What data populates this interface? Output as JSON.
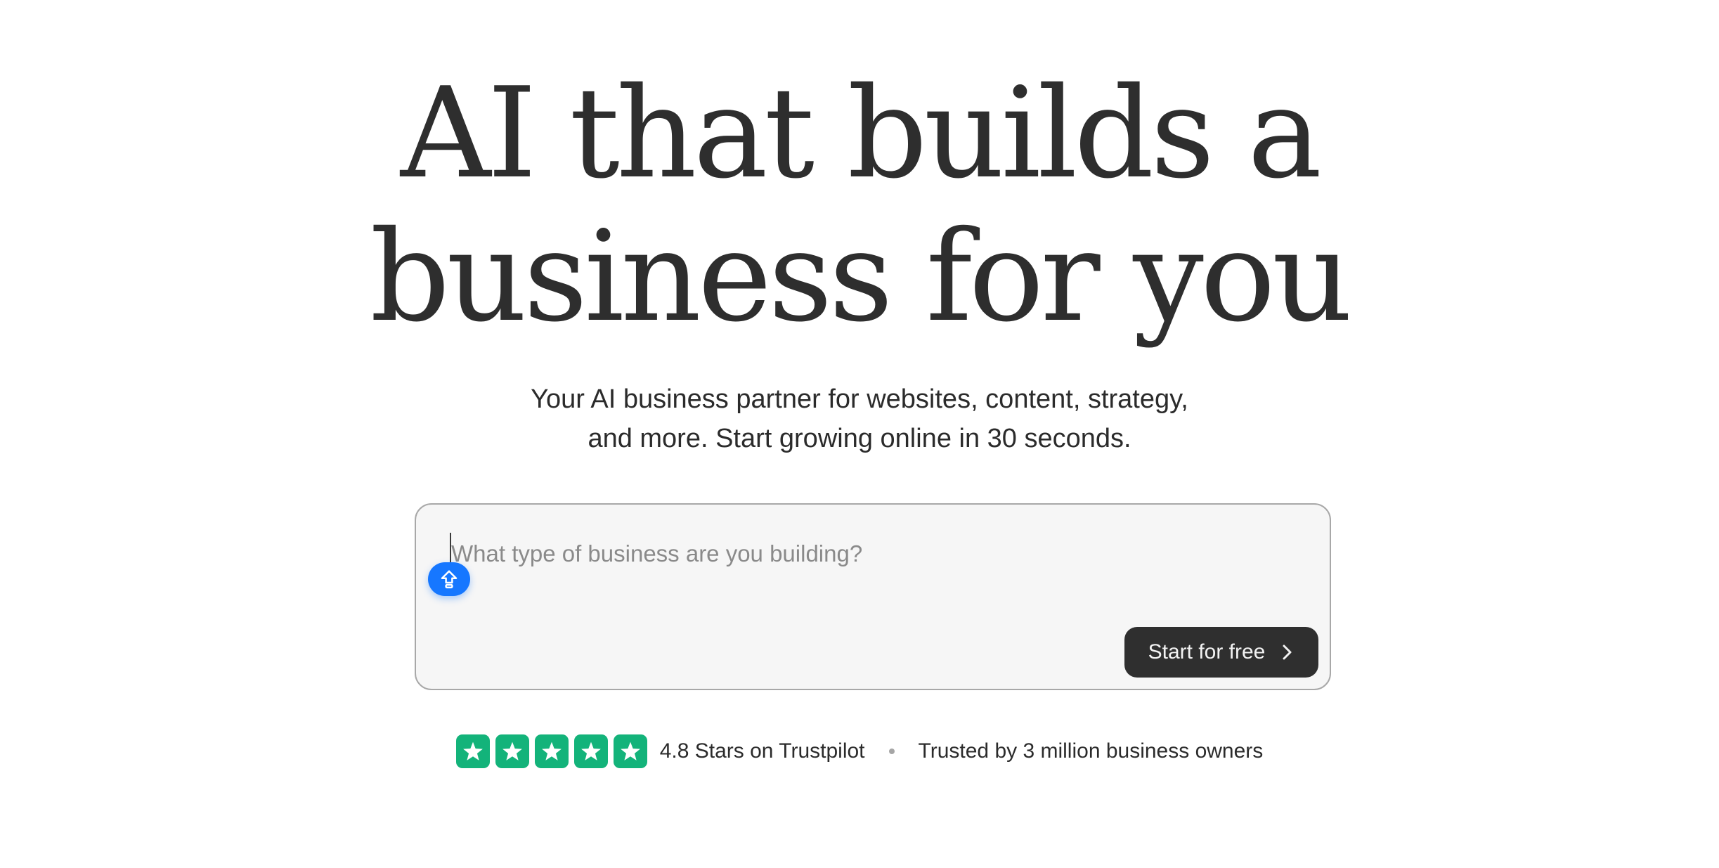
{
  "hero": {
    "headline_line1": "AI that builds a",
    "headline_line2": "business for you",
    "subheadline_line1": "Your AI business partner for websites, content, strategy,",
    "subheadline_line2": "and more. Start growing online in 30 seconds."
  },
  "prompt": {
    "placeholder": "What type of business are you building?",
    "value": "",
    "submit_label": "Start for free",
    "submit_icon": "chevron-right-icon",
    "assist_icon": "upload-arrow-icon"
  },
  "trust": {
    "rating_count": 5,
    "star_icon": "star-icon",
    "rating_label": "4.8 Stars on Trustpilot",
    "trusted_label": "Trusted by 3 million business owners"
  },
  "colors": {
    "text": "#2e2e2e",
    "button_background": "#2f2f2f",
    "assist_blue": "#1677ff",
    "trustpilot_green": "#13b37a",
    "input_background": "#f6f6f6"
  }
}
